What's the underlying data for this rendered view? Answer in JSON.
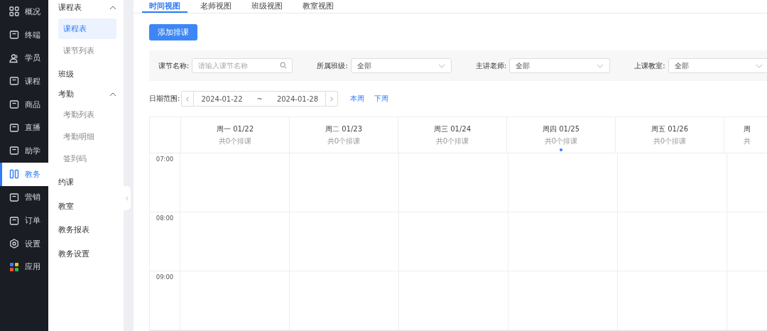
{
  "sidebar": {
    "items": [
      {
        "label": "概况",
        "selected": false
      },
      {
        "label": "终端",
        "selected": false
      },
      {
        "label": "学员",
        "selected": false
      },
      {
        "label": "课程",
        "selected": false
      },
      {
        "label": "商品",
        "selected": false
      },
      {
        "label": "直播",
        "selected": false
      },
      {
        "label": "助学",
        "selected": false
      },
      {
        "label": "教务",
        "selected": true
      },
      {
        "label": "营销",
        "selected": false
      },
      {
        "label": "订单",
        "selected": false
      },
      {
        "label": "设置",
        "selected": false
      },
      {
        "label": "应用",
        "selected": false
      }
    ]
  },
  "submenu": {
    "items": [
      {
        "label": "课程表",
        "expanded": true,
        "children": [
          {
            "label": "课程表",
            "selected": true
          },
          {
            "label": "课节列表",
            "selected": false
          }
        ]
      },
      {
        "label": "班级",
        "selected": false
      },
      {
        "label": "考勤",
        "expanded": true,
        "children": [
          {
            "label": "考勤列表",
            "selected": false
          },
          {
            "label": "考勤明细",
            "selected": false
          },
          {
            "label": "签到码",
            "selected": false
          }
        ]
      },
      {
        "label": "约课",
        "selected": false
      },
      {
        "label": "教室",
        "selected": false
      },
      {
        "label": "教务报表",
        "selected": false
      },
      {
        "label": "教务设置",
        "selected": false
      }
    ]
  },
  "tabs": [
    {
      "label": "时间视图",
      "selected": true
    },
    {
      "label": "老师视图",
      "selected": false
    },
    {
      "label": "班级视图",
      "selected": false
    },
    {
      "label": "教室视图",
      "selected": false
    }
  ],
  "add_button": "添加排课",
  "filters": [
    {
      "kind": "search",
      "label": "课节名称:",
      "placeholder": "请输入课节名称"
    },
    {
      "kind": "select",
      "label": "所属班级:",
      "value": "全部"
    },
    {
      "kind": "select",
      "label": "主讲老师:",
      "value": "全部"
    },
    {
      "kind": "select",
      "label": "上课教室:",
      "value": "全部"
    }
  ],
  "date_range": {
    "label": "日期范围:",
    "start": "2024-01-22",
    "separator": "~",
    "end": "2024-01-28",
    "links": [
      "本周",
      "下周"
    ]
  },
  "calendar": {
    "days": [
      {
        "title": "周一 01/22",
        "count": "共0个排课",
        "today": false
      },
      {
        "title": "周二 01/23",
        "count": "共0个排课",
        "today": false
      },
      {
        "title": "周三 01/24",
        "count": "共0个排课",
        "today": false
      },
      {
        "title": "周四 01/25",
        "count": "共0个排课",
        "today": true
      },
      {
        "title": "周五 01/26",
        "count": "共0个排课",
        "today": false
      },
      {
        "title": "周",
        "count": "共",
        "today": false
      }
    ],
    "times": [
      "07:00",
      "08:00",
      "09:00"
    ]
  }
}
